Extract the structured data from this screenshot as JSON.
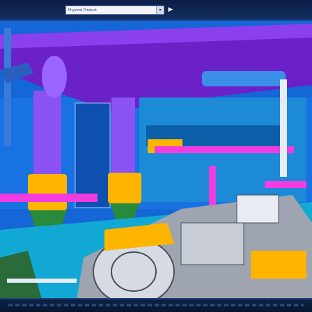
{
  "toolbar": {
    "product_selector": {
      "value": "Physical Product",
      "button_icon": "dropdown-arrow-icon"
    },
    "navigate_icon": "play-arrow-icon"
  },
  "viewport": {
    "content": "3d-plant-model",
    "colors": {
      "ceiling_duct": "#7b28d6",
      "wall": "#1473e6",
      "floor": "#12b0d8",
      "pipe_purple": "#8a4ff0",
      "pipe_magenta": "#f23ce0",
      "flange_yellow": "#ffb400",
      "cone_green": "#2a8a3c",
      "machinery_gray": "#c8ccd4"
    }
  }
}
